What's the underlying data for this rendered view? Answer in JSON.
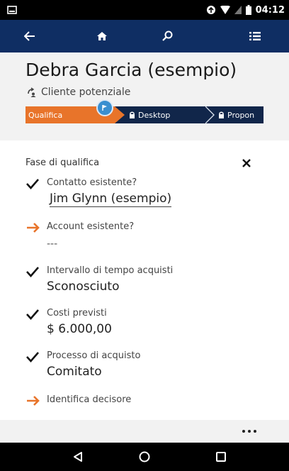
{
  "status_bar": {
    "time": "04:12",
    "icons": [
      "notification-icon",
      "data-sync-icon",
      "wifi-icon",
      "signal-icon",
      "battery-icon"
    ]
  },
  "nav_bar": {
    "background": "#0f2e63",
    "buttons": [
      {
        "name": "back-button",
        "icon": "arrow-left-icon"
      },
      {
        "name": "home-button",
        "icon": "home-icon"
      },
      {
        "name": "search-button",
        "icon": "search-icon"
      },
      {
        "name": "menu-button",
        "icon": "list-icon"
      }
    ]
  },
  "record": {
    "name": "Debra Garcia (esempio)",
    "type": "Cliente potenziale",
    "type_icon": "lead-icon"
  },
  "process_bar": {
    "active_color": "#e8742a",
    "stages": [
      {
        "label": "Qualifica",
        "active": true,
        "locked": false
      },
      {
        "label": "Desktop",
        "active": false,
        "locked": true
      },
      {
        "label": "Propon",
        "active": false,
        "locked": true
      }
    ]
  },
  "stage_panel": {
    "title": "Fase di qualifica",
    "steps": [
      {
        "label": "Contatto esistente?",
        "value": "Jim Glynn (esempio)",
        "status": "done",
        "is_link": true
      },
      {
        "label": "Account esistente?",
        "value": "---",
        "status": "pending",
        "is_link": false
      },
      {
        "label": "Intervallo di tempo acquisti",
        "value": "Sconosciuto",
        "status": "done",
        "is_link": false
      },
      {
        "label": "Costi previsti",
        "value": "$ 6.000,00",
        "status": "done",
        "is_link": false
      },
      {
        "label": "Processo di acquisto",
        "value": "Comitato",
        "status": "done",
        "is_link": false
      },
      {
        "label": "Identifica decisore",
        "value": "",
        "status": "pending",
        "is_link": false
      }
    ],
    "colors": {
      "done": "#111111",
      "pending": "#e8742a"
    }
  },
  "command_bar": {
    "more_icon": "more-icon"
  },
  "android_nav": {
    "buttons": [
      "back-triangle-icon",
      "home-circle-icon",
      "recents-square-icon"
    ]
  }
}
